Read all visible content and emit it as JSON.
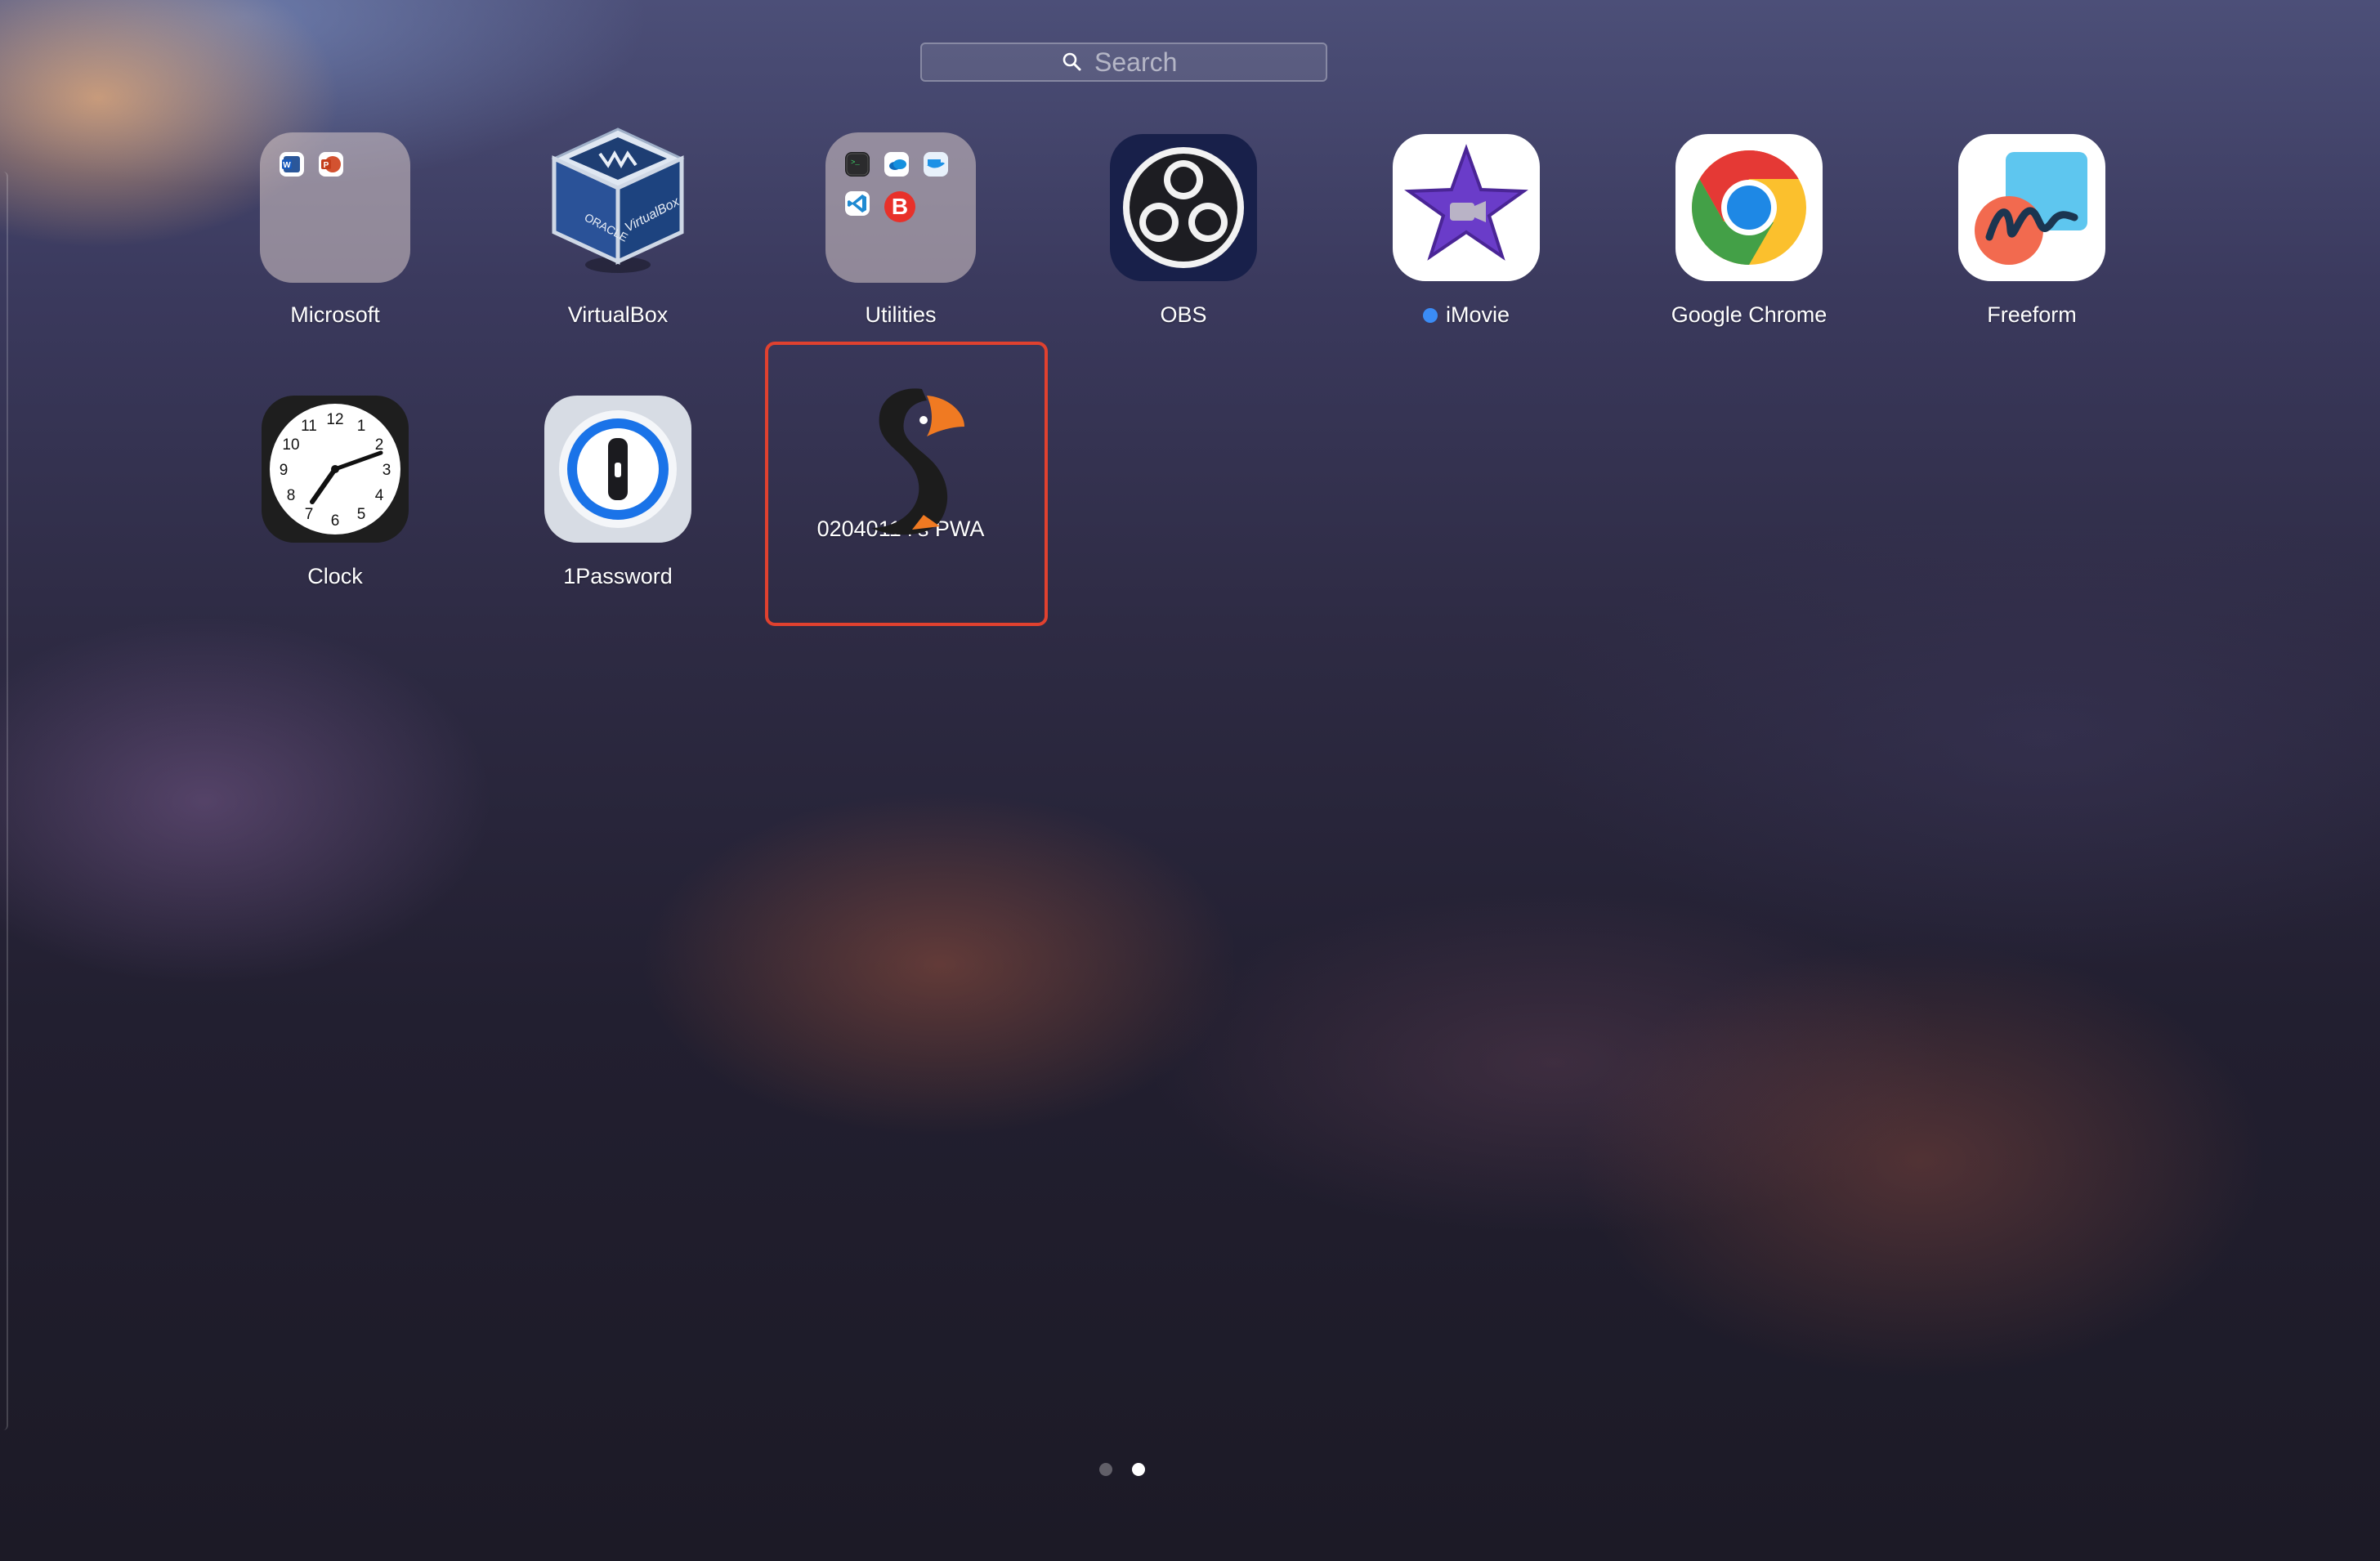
{
  "search": {
    "placeholder": "Search"
  },
  "apps": [
    {
      "name": "Microsoft",
      "icon": "microsoft-folder-icon"
    },
    {
      "name": "VirtualBox",
      "icon": "virtualbox-icon"
    },
    {
      "name": "Utilities",
      "icon": "utilities-folder-icon"
    },
    {
      "name": "OBS",
      "icon": "obs-icon"
    },
    {
      "name": "iMovie",
      "icon": "imovie-icon",
      "new_indicator": true
    },
    {
      "name": "Google Chrome",
      "icon": "chrome-icon"
    },
    {
      "name": "Freeform",
      "icon": "freeform-icon"
    },
    {
      "name": "Clock",
      "icon": "clock-icon"
    },
    {
      "name": "1Password",
      "icon": "1password-icon"
    },
    {
      "name": "02040114's PWA",
      "icon": "puffin-pwa-icon",
      "selected": true
    }
  ],
  "clock": {
    "numerals": [
      "12",
      "1",
      "2",
      "3",
      "4",
      "5",
      "6",
      "7",
      "8",
      "9",
      "10",
      "11"
    ]
  },
  "utilities_folder": {
    "badge_letter": "B"
  },
  "pagination": {
    "pages": 2,
    "current": 2
  },
  "colors": {
    "selection_border": "#e0412f",
    "new_indicator": "#3b8cf5"
  }
}
